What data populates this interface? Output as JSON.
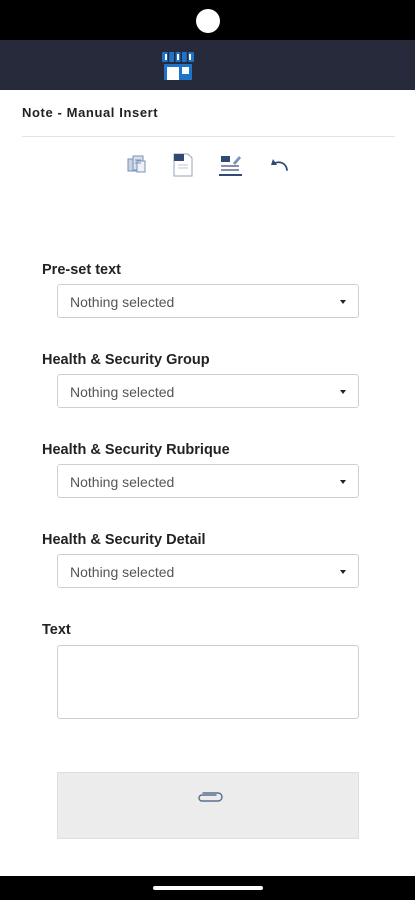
{
  "header": {
    "icon": "store-icon",
    "background_color": "#262a3b",
    "accent_color": "#1f74c9"
  },
  "page": {
    "title": "Note - Manual Insert"
  },
  "toolbar": {
    "tools": [
      "copy-documents-icon",
      "insert-document-icon",
      "edit-list-icon",
      "undo-icon"
    ]
  },
  "form": {
    "preset_text": {
      "label": "Pre-set text",
      "value": "Nothing selected"
    },
    "hs_group": {
      "label": "Health & Security Group",
      "value": "Nothing selected"
    },
    "hs_rubrique": {
      "label": "Health & Security Rubrique",
      "value": "Nothing selected"
    },
    "hs_detail": {
      "label": "Health & Security Detail",
      "value": "Nothing selected"
    },
    "text": {
      "label": "Text",
      "value": ""
    }
  },
  "attachment": {
    "icon": "paperclip-icon"
  }
}
